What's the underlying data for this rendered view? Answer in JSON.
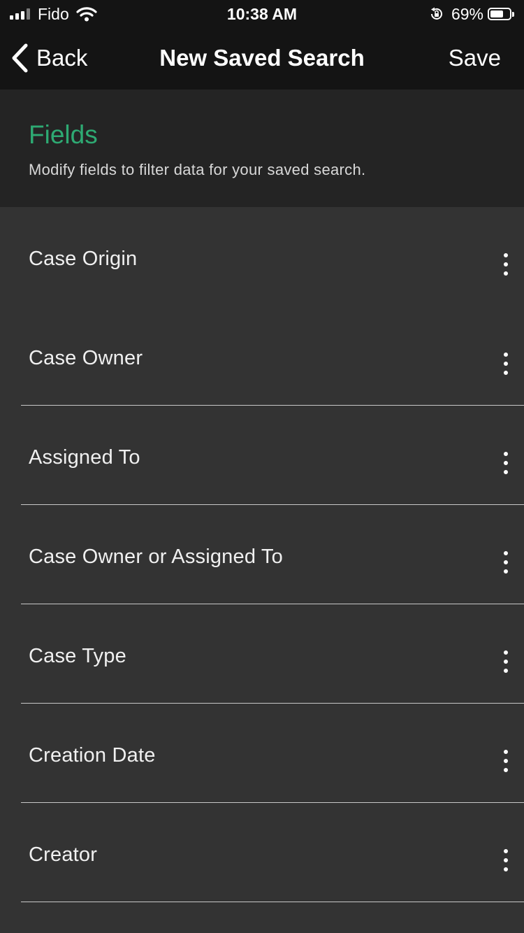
{
  "status_bar": {
    "carrier": "Fido",
    "time": "10:38 AM",
    "battery_percent": "69%",
    "battery_level": 0.69,
    "icons": [
      "signal-icon",
      "wifi-icon",
      "rotation-lock-icon",
      "battery-icon"
    ]
  },
  "nav": {
    "back_label": "Back",
    "title": "New Saved Search",
    "save_label": "Save"
  },
  "section": {
    "title": "Fields",
    "subtitle": "Modify fields to filter data for your saved search."
  },
  "fields": [
    {
      "label": "Case Origin"
    },
    {
      "label": "Case Owner"
    },
    {
      "label": "Assigned To"
    },
    {
      "label": "Case Owner or Assigned To"
    },
    {
      "label": "Case Type"
    },
    {
      "label": "Creation Date"
    },
    {
      "label": "Creator"
    }
  ],
  "colors": {
    "accent": "#2eaa73",
    "bar_background": "#141414",
    "header_background": "#242424",
    "list_background": "#333333"
  }
}
